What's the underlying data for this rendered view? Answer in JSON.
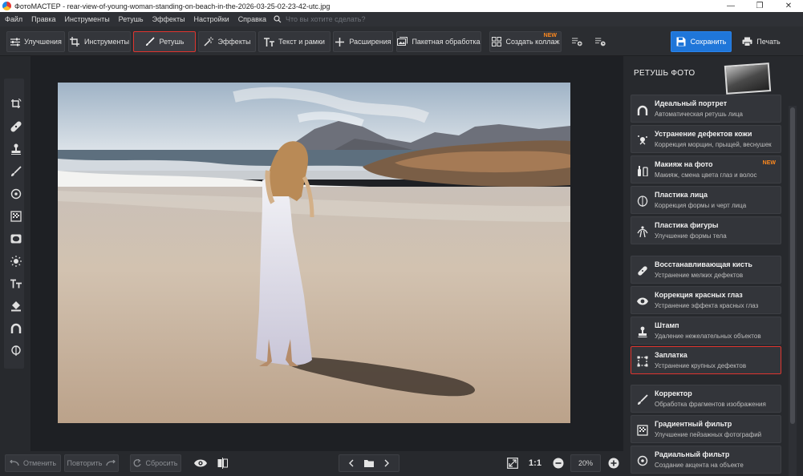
{
  "window": {
    "title": "ФотоМАСТЕР - rear-view-of-young-woman-standing-on-beach-in-the-2026-03-25-02-23-42-utc.jpg",
    "controls": [
      "—",
      "❐",
      "✕"
    ]
  },
  "menu": {
    "items": [
      "Файл",
      "Правка",
      "Инструменты",
      "Ретушь",
      "Эффекты",
      "Настройки",
      "Справка"
    ],
    "search_placeholder": "Что вы хотите сделать?"
  },
  "toolbar": {
    "enhance": "Улучшения",
    "tools": "Инструменты",
    "retouch": "Ретушь",
    "effects": "Эффекты",
    "text_frames": "Текст и рамки",
    "extensions": "Расширения",
    "batch": "Пакетная обработка",
    "collage": "Создать коллаж",
    "collage_badge": "NEW",
    "save": "Сохранить",
    "print": "Печать"
  },
  "left_tools": [
    "crop-rotate-icon",
    "heal-icon",
    "stamp-icon",
    "brush-icon",
    "radial-icon",
    "gradient-icon",
    "vignette-icon",
    "light-icon",
    "text-icon",
    "fill-icon",
    "magnet-icon",
    "plastic-icon"
  ],
  "panel": {
    "title": "РЕТУШЬ ФОТО",
    "items": [
      {
        "name": "Идеальный портрет",
        "desc": "Автоматическая ретушь лица",
        "icon": "portrait-icon",
        "badge": ""
      },
      {
        "name": "Устранение дефектов кожи",
        "desc": "Коррекция морщин, прыщей, веснушек",
        "icon": "skin-icon",
        "badge": ""
      },
      {
        "name": "Макияж на фото",
        "desc": "Макияж, смена цвета глаз и волос",
        "icon": "makeup-icon",
        "badge": "NEW"
      },
      {
        "name": "Пластика лица",
        "desc": "Коррекция формы и черт лица",
        "icon": "face-shape-icon",
        "badge": ""
      },
      {
        "name": "Пластика фигуры",
        "desc": "Улучшение формы тела",
        "icon": "figure-icon",
        "badge": ""
      },
      {
        "name": "Восстанавливающая кисть",
        "desc": "Устранение мелких дефектов",
        "icon": "heal-brush-icon",
        "badge": ""
      },
      {
        "name": "Коррекция красных глаз",
        "desc": "Устранение эффекта красных глаз",
        "icon": "eye-icon",
        "badge": ""
      },
      {
        "name": "Штамп",
        "desc": "Удаление нежелательных объектов",
        "icon": "stamp-icon",
        "badge": ""
      },
      {
        "name": "Заплатка",
        "desc": "Устранение крупных дефектов",
        "icon": "patch-icon",
        "badge": ""
      },
      {
        "name": "Корректор",
        "desc": "Обработка фрагментов изображения",
        "icon": "corrector-icon",
        "badge": ""
      },
      {
        "name": "Градиентный фильтр",
        "desc": "Улучшение пейзажных фотографий",
        "icon": "gradient-icon",
        "badge": ""
      },
      {
        "name": "Радиальный фильтр",
        "desc": "Создание акцента на объекте",
        "icon": "radial-icon",
        "badge": ""
      }
    ]
  },
  "bottom": {
    "undo": "Отменить",
    "redo": "Повторить",
    "reset": "Сбросить",
    "ratio": "1:1",
    "zoom": "20%"
  },
  "colors": {
    "accent": "#1f76d9",
    "highlight": "#e0352f",
    "badge": "#ff8a1f"
  }
}
